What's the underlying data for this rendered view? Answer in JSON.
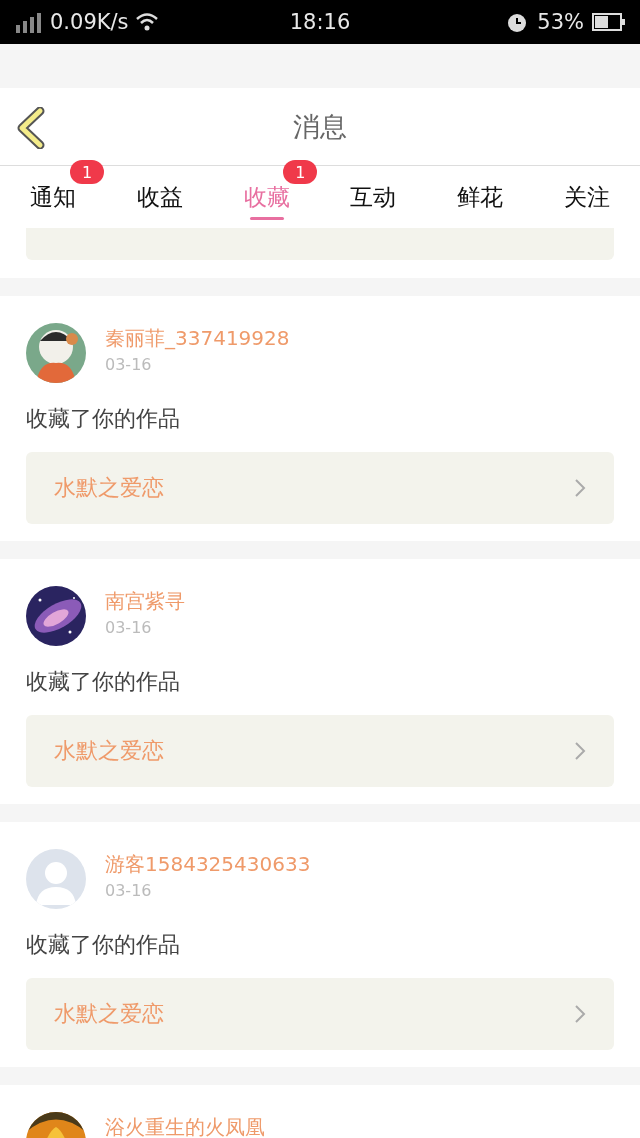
{
  "status_bar": {
    "speed": "0.09K/s",
    "time": "18:16",
    "battery": "53%"
  },
  "header": {
    "title": "消息"
  },
  "tabs": [
    {
      "label": "通知",
      "selected": false,
      "badge": "1"
    },
    {
      "label": "收益",
      "selected": false
    },
    {
      "label": "收藏",
      "selected": true,
      "badge": "1"
    },
    {
      "label": "互动",
      "selected": false
    },
    {
      "label": "鲜花",
      "selected": false
    },
    {
      "label": "关注",
      "selected": false
    }
  ],
  "messages": [
    {
      "kind": "picture",
      "name": "秦丽菲_337419928",
      "date": "03-16",
      "action": "收藏了你的作品",
      "work": "水默之爱恋"
    },
    {
      "kind": "picture",
      "name": "南宫紫寻",
      "date": "03-16",
      "action": "收藏了你的作品",
      "work": "水默之爱恋"
    },
    {
      "kind": "silhouette",
      "name": "游客1584325430633",
      "date": "03-16",
      "action": "收藏了你的作品",
      "work": "水默之爱恋"
    },
    {
      "kind": "picture",
      "name": "浴火重生的火凤凰"
    }
  ]
}
